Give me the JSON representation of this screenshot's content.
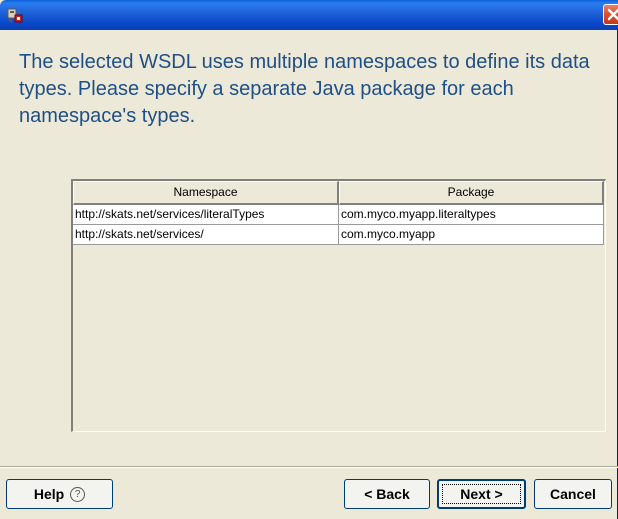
{
  "window": {
    "close_icon": "close-icon",
    "app_icon": "wizard-app-icon"
  },
  "instructions": "The selected WSDL uses multiple namespaces to define its data types.  Please specify a separate Java package for each namespace's types.",
  "table": {
    "columns": [
      "Namespace",
      "Package"
    ],
    "rows": [
      {
        "namespace": "http://skats.net/services/literalTypes",
        "package": "com.myco.myapp.literaltypes"
      },
      {
        "namespace": "http://skats.net/services/",
        "package": "com.myco.myapp"
      }
    ]
  },
  "buttons": {
    "help": "Help",
    "help_icon": "?",
    "back": "< Back",
    "next": "Next >",
    "cancel": "Cancel"
  },
  "colors": {
    "titlebar": "#0a5fd8",
    "instructions_text": "#1f4f86",
    "close_button": "#d9502c"
  }
}
